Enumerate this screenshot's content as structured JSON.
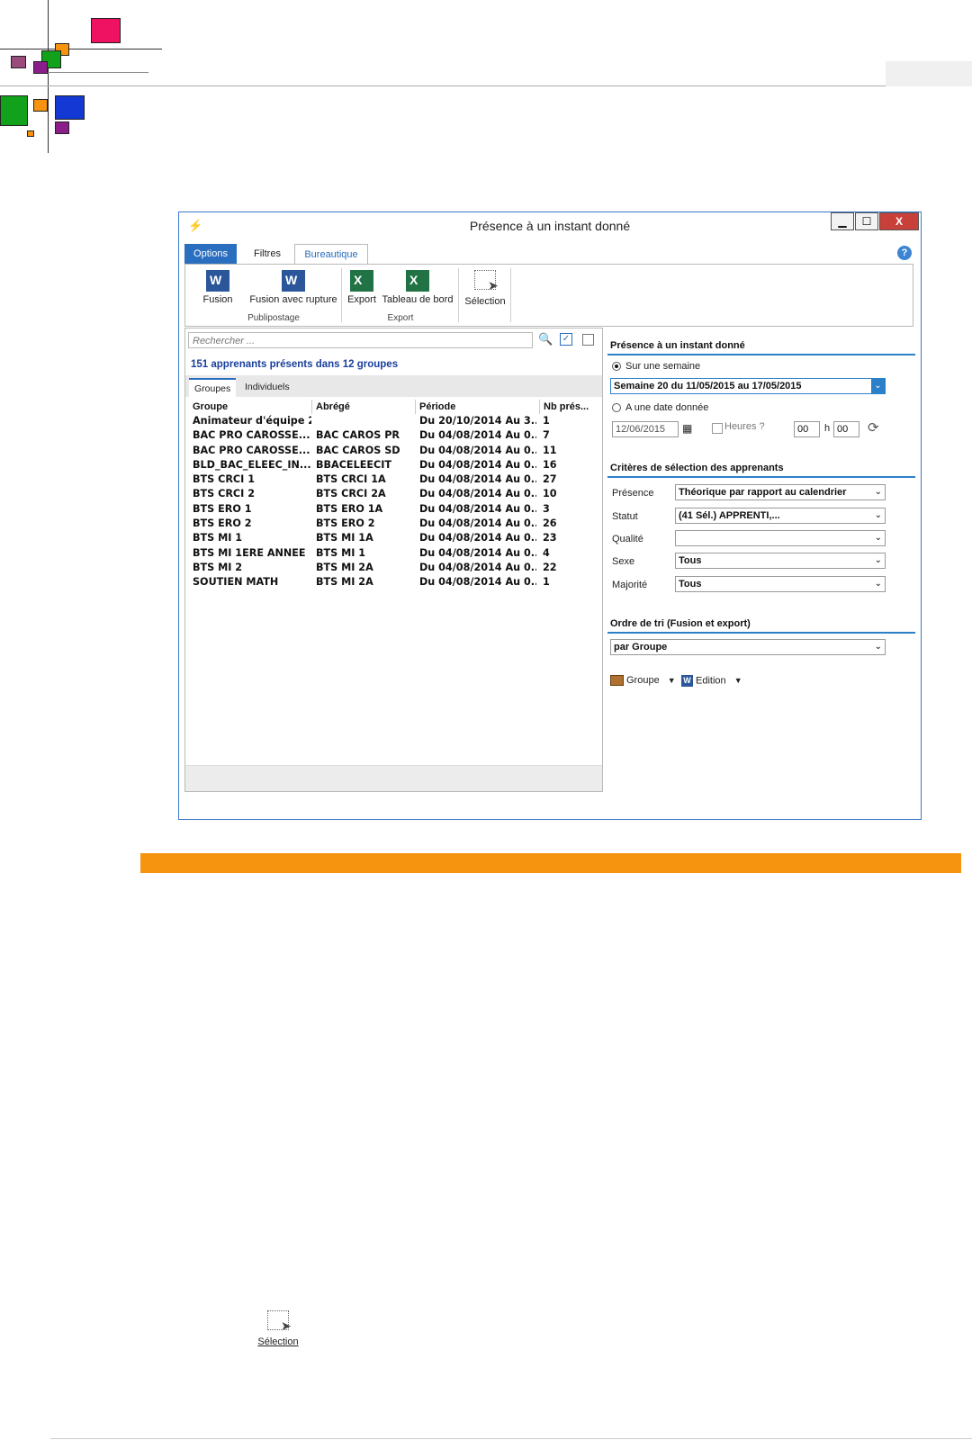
{
  "window": {
    "title": "Présence à un instant donné",
    "minimize": "▁",
    "maximize": "☐",
    "close": "X"
  },
  "ribbon": {
    "tabs": [
      "Options",
      "Filtres",
      "Bureautique"
    ],
    "help": "?",
    "buttons": {
      "fusion": "Fusion",
      "fusion_rupture": "Fusion avec rupture",
      "export": "Export",
      "tableau": "Tableau de bord",
      "selection": "Sélection"
    },
    "groups": {
      "publipostage": "Publipostage",
      "export": "Export"
    }
  },
  "left": {
    "search_placeholder": "Rechercher ...",
    "count_text": "151 apprenants présents dans 12 groupes",
    "subtabs": [
      "Groupes",
      "Individuels"
    ],
    "columns": [
      "Groupe",
      "Abrégé",
      "Période",
      "Nb prés..."
    ],
    "rows": [
      [
        "Animateur d'équipe 2...",
        "",
        "Du 20/10/2014 Au 3...",
        "1"
      ],
      [
        "BAC PRO CAROSSE...",
        "BAC CAROS PR",
        "Du 04/08/2014 Au 0...",
        "7"
      ],
      [
        "BAC PRO CAROSSE...",
        "BAC CAROS SD",
        "Du 04/08/2014 Au 0...",
        "11"
      ],
      [
        "BLD_BAC_ELEEC_IN...",
        "BBACELEECIT",
        "Du 04/08/2014 Au 0...",
        "16"
      ],
      [
        "BTS CRCI 1",
        "BTS CRCI 1A",
        "Du 04/08/2014 Au 0...",
        "27"
      ],
      [
        "BTS CRCI 2",
        "BTS CRCI 2A",
        "Du 04/08/2014 Au 0...",
        "10"
      ],
      [
        "BTS ERO 1",
        "BTS ERO 1A",
        "Du 04/08/2014 Au 0...",
        "3"
      ],
      [
        "BTS ERO 2",
        "BTS ERO 2",
        "Du 04/08/2014 Au 0...",
        "26"
      ],
      [
        "BTS MI 1",
        "BTS MI 1A",
        "Du 04/08/2014 Au 0...",
        "23"
      ],
      [
        "BTS MI 1ERE ANNEE",
        "BTS MI 1",
        "Du 04/08/2014 Au 0...",
        "4"
      ],
      [
        "BTS MI 2",
        "BTS MI 2A",
        "Du 04/08/2014 Au 0...",
        "22"
      ],
      [
        "SOUTIEN MATH",
        "BTS MI 2A",
        "Du 04/08/2014 Au 0...",
        "1"
      ]
    ]
  },
  "right": {
    "section1": "Présence à un instant donné",
    "radio_week": "Sur une semaine",
    "week_value": "Semaine 20 du 11/05/2015 au 17/05/2015",
    "radio_date": "A une date donnée",
    "date_value": "12/06/2015",
    "hours_label": "Heures ?",
    "hour_value": "00",
    "h_label": "h",
    "min_value": "00",
    "section2": "Critères de sélection des apprenants",
    "criteria": {
      "presence_label": "Présence",
      "presence_value": "Théorique par rapport au calendrier",
      "statut_label": "Statut",
      "statut_value": "(41 Sél.) APPRENTI,...",
      "qualite_label": "Qualité",
      "qualite_value": "",
      "sexe_label": "Sexe",
      "sexe_value": "Tous",
      "majorite_label": "Majorité",
      "majorite_value": "Tous"
    },
    "section3": "Ordre de tri (Fusion et export)",
    "sort_value": "par Groupe",
    "groupe_btn": "Groupe",
    "edition_btn": "Edition"
  },
  "below": {
    "selection_label": "Sélection"
  },
  "colors": {
    "accent": "#2a6ebf",
    "orange_bar": "#f7940f"
  }
}
